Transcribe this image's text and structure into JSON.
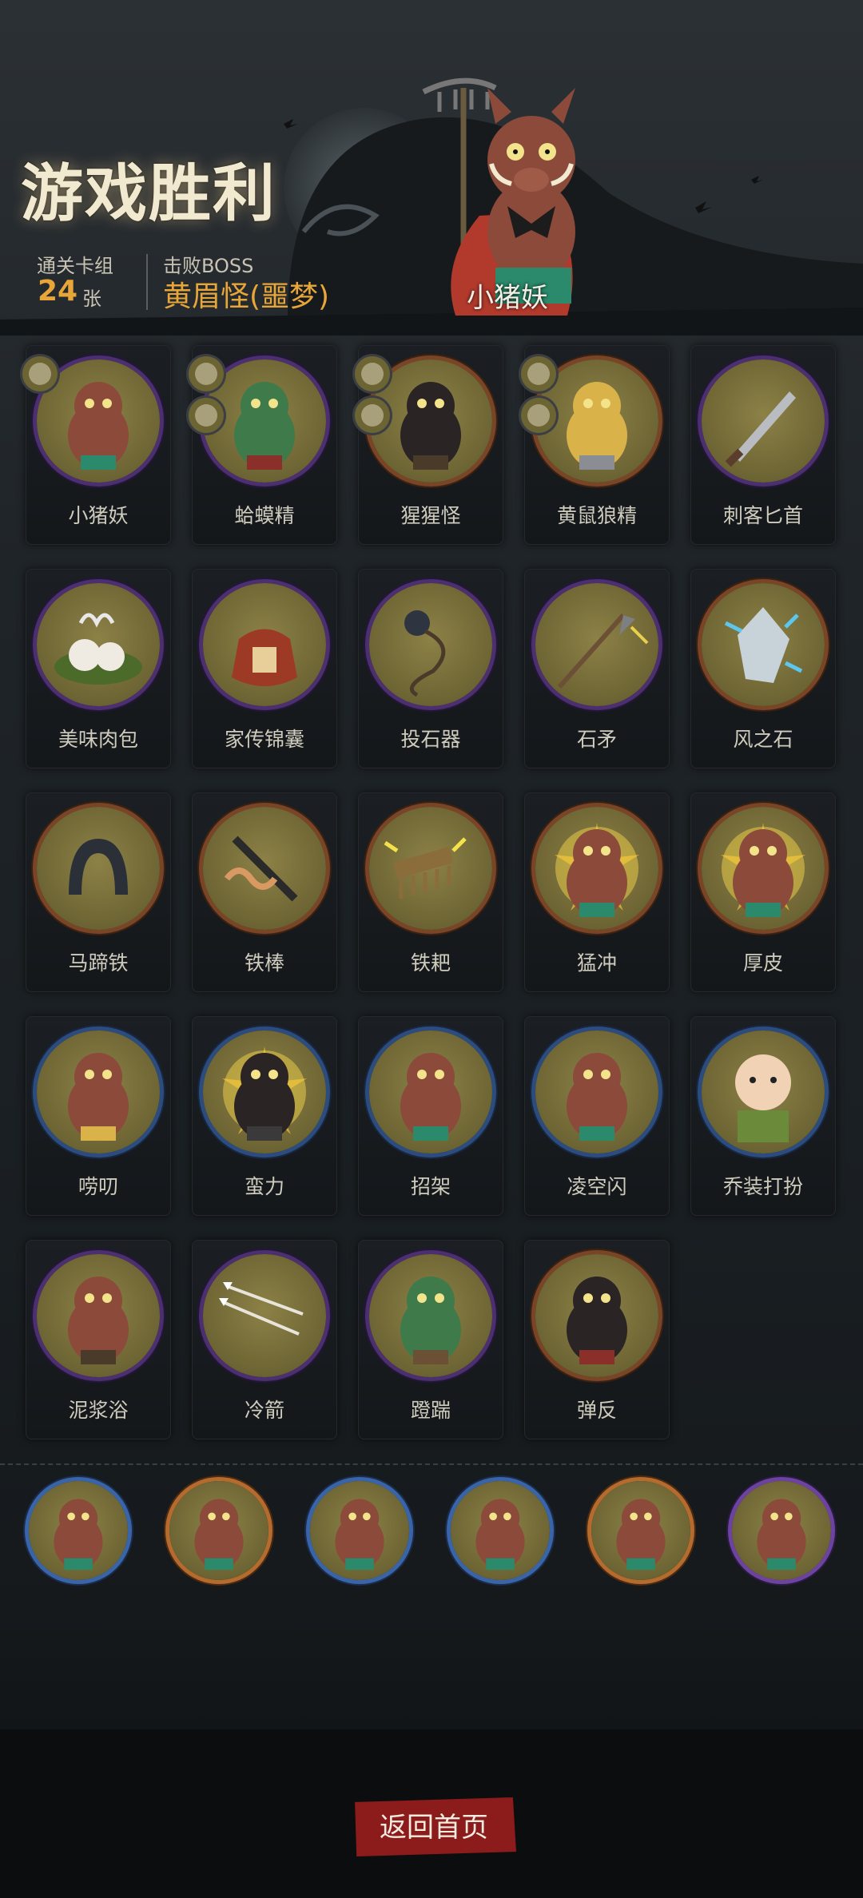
{
  "header": {
    "title": "游戏胜利",
    "cleared_deck_label": "通关卡组",
    "cleared_deck_count": "24",
    "cleared_deck_unit": "张",
    "defeated_boss_label": "击败BOSS",
    "defeated_boss_name": "黄眉怪(噩梦)",
    "boss_portrait_name": "小猪妖"
  },
  "cards": [
    {
      "name": "小猪妖",
      "ring": "purple",
      "icon": "boar-demon-icon",
      "badges": [
        "tiger-badge-icon"
      ]
    },
    {
      "name": "蛤蟆精",
      "ring": "purple",
      "icon": "toad-demon-icon",
      "badges": [
        "ox-badge-icon",
        "club-badge-icon"
      ]
    },
    {
      "name": "猩猩怪",
      "ring": "orange",
      "icon": "ape-demon-icon",
      "badges": [
        "lotus-badge-icon",
        "mace-badge-icon"
      ]
    },
    {
      "name": "黄鼠狼精",
      "ring": "orange",
      "icon": "weasel-demon-icon",
      "badges": [
        "dagger-badge-icon",
        "claw-badge-icon"
      ]
    },
    {
      "name": "刺客匕首",
      "ring": "purple",
      "icon": "assassin-dagger-icon",
      "badges": []
    },
    {
      "name": "美味肉包",
      "ring": "purple",
      "icon": "steamed-bun-icon",
      "badges": []
    },
    {
      "name": "家传锦囊",
      "ring": "purple",
      "icon": "brocade-pouch-icon",
      "badges": []
    },
    {
      "name": "投石器",
      "ring": "purple",
      "icon": "sling-icon",
      "badges": []
    },
    {
      "name": "石矛",
      "ring": "purple",
      "icon": "stone-spear-icon",
      "badges": []
    },
    {
      "name": "风之石",
      "ring": "orange",
      "icon": "wind-stone-icon",
      "badges": []
    },
    {
      "name": "马蹄铁",
      "ring": "orange",
      "icon": "horseshoe-icon",
      "badges": []
    },
    {
      "name": "铁棒",
      "ring": "orange",
      "icon": "iron-rod-icon",
      "badges": []
    },
    {
      "name": "铁耙",
      "ring": "orange",
      "icon": "iron-rake-icon",
      "badges": []
    },
    {
      "name": "猛冲",
      "ring": "orange",
      "icon": "charge-icon",
      "badges": []
    },
    {
      "name": "厚皮",
      "ring": "orange",
      "icon": "thick-skin-icon",
      "badges": []
    },
    {
      "name": "唠叨",
      "ring": "blue",
      "icon": "nagging-icon",
      "badges": []
    },
    {
      "name": "蛮力",
      "ring": "blue",
      "icon": "brute-force-icon",
      "badges": []
    },
    {
      "name": "招架",
      "ring": "blue",
      "icon": "parry-icon",
      "badges": []
    },
    {
      "name": "凌空闪",
      "ring": "blue",
      "icon": "air-dodge-icon",
      "badges": []
    },
    {
      "name": "乔装打扮",
      "ring": "blue",
      "icon": "disguise-icon",
      "badges": []
    },
    {
      "name": "泥浆浴",
      "ring": "purple",
      "icon": "mud-bath-icon",
      "badges": []
    },
    {
      "name": "冷箭",
      "ring": "purple",
      "icon": "cold-arrow-icon",
      "badges": []
    },
    {
      "name": "蹬踹",
      "ring": "purple",
      "icon": "kick-icon",
      "badges": []
    },
    {
      "name": "弹反",
      "ring": "orange",
      "icon": "counter-icon",
      "badges": []
    }
  ],
  "deck_tokens": [
    {
      "ring": "blue",
      "icon": "boar-attack-token-icon"
    },
    {
      "ring": "orange",
      "icon": "white-horse-token-icon"
    },
    {
      "ring": "blue",
      "icon": "lightning-beast-token-icon"
    },
    {
      "ring": "blue",
      "icon": "horn-token-icon"
    },
    {
      "ring": "orange",
      "icon": "boar-duo-token-icon"
    },
    {
      "ring": "purple",
      "icon": "kick-token-icon"
    }
  ],
  "footer": {
    "back_button_label": "返回首页"
  },
  "colors": {
    "accent_gold": "#e8a638",
    "button_red": "#8c1b1b",
    "ring_purple": "#4b2f6e",
    "ring_orange": "#7a4526",
    "ring_blue": "#2d4c7e"
  }
}
